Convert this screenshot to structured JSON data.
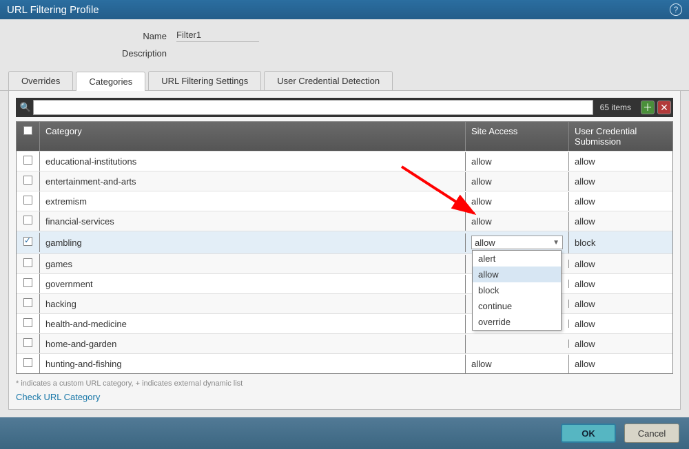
{
  "title": "URL Filtering Profile",
  "form": {
    "name_label": "Name",
    "name_value": "Filter1",
    "description_label": "Description",
    "description_value": ""
  },
  "tabs": {
    "overrides": "Overrides",
    "categories": "Categories",
    "url_settings": "URL Filtering Settings",
    "cred_detect": "User Credential Detection",
    "active": "categories"
  },
  "toolbar": {
    "search_placeholder": "",
    "item_count": "65 items",
    "add_icon": "＋",
    "delete_icon": "✕",
    "search_icon": "🔍"
  },
  "columns": {
    "category": "Category",
    "site_access": "Site Access",
    "user_cred": "User Credential Submission"
  },
  "rows": [
    {
      "category": "educational-institutions",
      "site_access": "allow",
      "user_cred": "allow",
      "checked": false
    },
    {
      "category": "entertainment-and-arts",
      "site_access": "allow",
      "user_cred": "allow",
      "checked": false
    },
    {
      "category": "extremism",
      "site_access": "allow",
      "user_cred": "allow",
      "checked": false
    },
    {
      "category": "financial-services",
      "site_access": "allow",
      "user_cred": "allow",
      "checked": false
    },
    {
      "category": "gambling",
      "site_access": "allow",
      "user_cred": "block",
      "checked": true,
      "selected": true,
      "dropdown_open": true
    },
    {
      "category": "games",
      "site_access": "",
      "user_cred": "allow",
      "checked": false
    },
    {
      "category": "government",
      "site_access": "",
      "user_cred": "allow",
      "checked": false
    },
    {
      "category": "hacking",
      "site_access": "",
      "user_cred": "allow",
      "checked": false
    },
    {
      "category": "health-and-medicine",
      "site_access": "",
      "user_cred": "allow",
      "checked": false
    },
    {
      "category": "home-and-garden",
      "site_access": "",
      "user_cred": "allow",
      "checked": false
    },
    {
      "category": "hunting-and-fishing",
      "site_access": "allow",
      "user_cred": "allow",
      "checked": false
    }
  ],
  "dropdown_options": [
    "alert",
    "allow",
    "block",
    "continue",
    "override"
  ],
  "dropdown_highlight": "allow",
  "footnote": "* indicates a custom URL category, + indicates external dynamic list",
  "check_link": "Check URL Category",
  "buttons": {
    "ok": "OK",
    "cancel": "Cancel"
  }
}
